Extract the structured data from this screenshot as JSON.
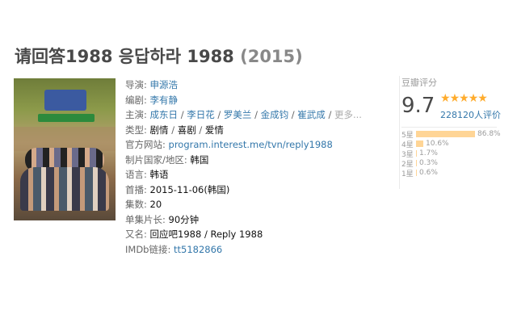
{
  "title": {
    "main": "请回答1988 응답하라 1988",
    "year": "(2015)"
  },
  "info": {
    "director": {
      "label": "导演:",
      "value": "申源浩"
    },
    "writer": {
      "label": "编剧:",
      "value": "李有静"
    },
    "cast": {
      "label": "主演:",
      "names": [
        "成东日",
        "李日花",
        "罗美兰",
        "金成钧",
        "崔武成"
      ],
      "more": "更多..."
    },
    "genre": {
      "label": "类型:",
      "values": [
        "剧情",
        "喜剧",
        "爱情"
      ]
    },
    "website": {
      "label": "官方网站:",
      "value": "program.interest.me/tvn/reply1988"
    },
    "country": {
      "label": "制片国家/地区:",
      "value": "韩国"
    },
    "language": {
      "label": "语言:",
      "value": "韩语"
    },
    "premiere": {
      "label": "首播:",
      "value": "2015-11-06(韩国)"
    },
    "episodes": {
      "label": "集数:",
      "value": "20"
    },
    "runtime": {
      "label": "单集片长:",
      "value": "90分钟"
    },
    "aka": {
      "label": "又名:",
      "value": "回应吧1988 / Reply 1988"
    },
    "imdb": {
      "label": "IMDb链接:",
      "value": "tt5182866"
    }
  },
  "rating": {
    "heading": "豆瓣评分",
    "score": "9.7",
    "stars": 5,
    "count": "228120人评价",
    "distribution": [
      {
        "label": "5星",
        "percent": 86.8,
        "text": "86.8%"
      },
      {
        "label": "4星",
        "percent": 10.6,
        "text": "10.6%"
      },
      {
        "label": "3星",
        "percent": 1.7,
        "text": "1.7%"
      },
      {
        "label": "2星",
        "percent": 0.3,
        "text": "0.3%"
      },
      {
        "label": "1星",
        "percent": 0.6,
        "text": "0.6%"
      }
    ],
    "star_color": "#ffac2d",
    "bar_color": "#ffd596",
    "link_color": "#3377aa"
  }
}
